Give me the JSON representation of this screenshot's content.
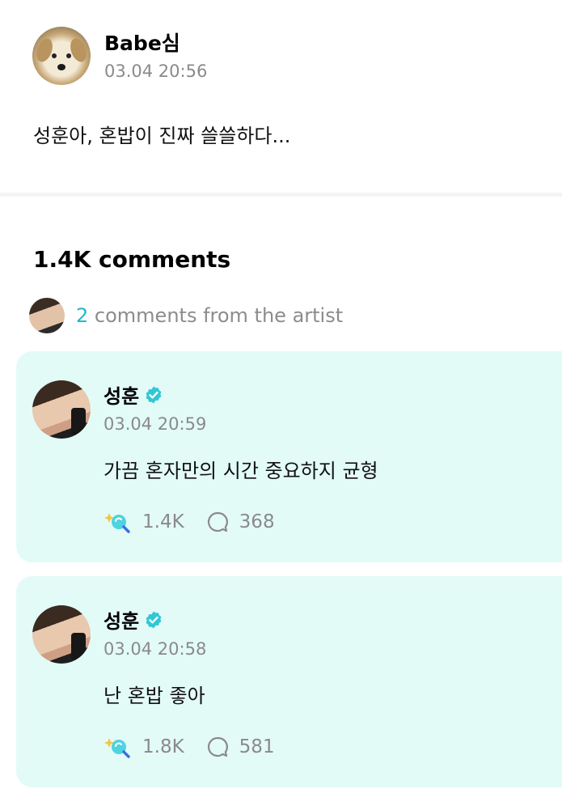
{
  "post": {
    "author": "Babe심",
    "time": "03.04 20:56",
    "text": "성훈아, 혼밥이 진짜 쓸쓸하다..."
  },
  "comments_header": {
    "count_label": "1.4K comments",
    "artist_count": "2",
    "artist_text": "comments from the artist"
  },
  "comments": [
    {
      "author": "성훈",
      "time": "03.04 20:59",
      "text": "가끔 혼자만의 시간 중요하지 균형",
      "likes": "1.4K",
      "replies": "368"
    },
    {
      "author": "성훈",
      "time": "03.04 20:58",
      "text": "난 혼밥 좋아",
      "likes": "1.8K",
      "replies": "581"
    }
  ],
  "colors": {
    "accent": "#22b8c8",
    "card_bg": "#e3fbf7",
    "muted": "#8a8a8a"
  },
  "icons": [
    "verified-badge-icon",
    "like-sparkle-icon",
    "reply-bubble-icon"
  ]
}
